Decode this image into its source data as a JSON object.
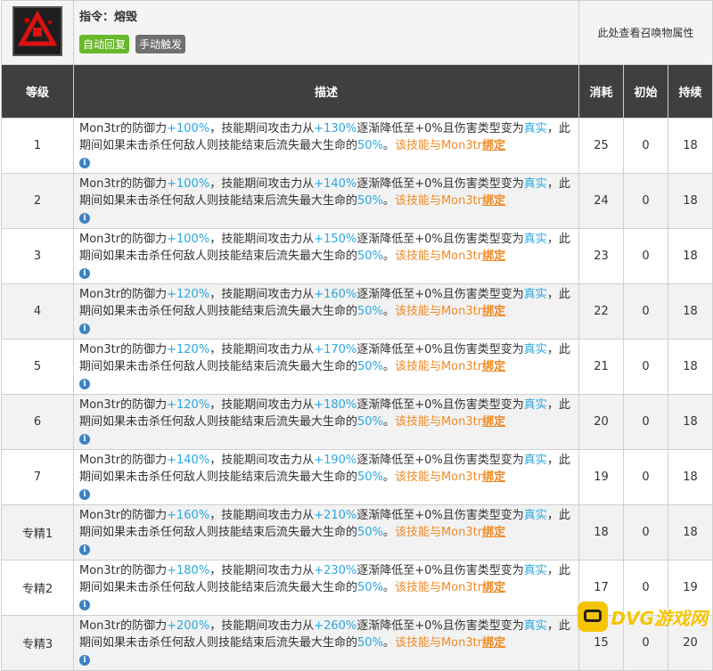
{
  "skill": {
    "title": "指令：熔毁",
    "tag_recovery": "自动回复",
    "tag_trigger": "手动触发",
    "summon_link": "此处查看召唤物属性"
  },
  "columns": {
    "level": "等级",
    "description": "描述",
    "cost": "消耗",
    "initial": "初始",
    "duration": "持续"
  },
  "desc_parts": {
    "p1": "Mon3tr的防御力",
    "p2": "，技能期间攻击力从",
    "p3": "逐渐降低至+0%且伤害类型变为",
    "true_dmg": "真实",
    "p4": "，此期间如果未击杀任何敌人则技能结束后流失最大生命的",
    "hp_loss": "50%",
    "p5": "。",
    "bind_text": "该技能与Mon3tr",
    "bind_link": "绑定"
  },
  "rows": [
    {
      "level": "1",
      "def": "+100%",
      "atk": "+130%",
      "cost": "25",
      "initial": "0",
      "duration": "18"
    },
    {
      "level": "2",
      "def": "+100%",
      "atk": "+140%",
      "cost": "24",
      "initial": "0",
      "duration": "18"
    },
    {
      "level": "3",
      "def": "+100%",
      "atk": "+150%",
      "cost": "23",
      "initial": "0",
      "duration": "18"
    },
    {
      "level": "4",
      "def": "+120%",
      "atk": "+160%",
      "cost": "22",
      "initial": "0",
      "duration": "18"
    },
    {
      "level": "5",
      "def": "+120%",
      "atk": "+170%",
      "cost": "21",
      "initial": "0",
      "duration": "18"
    },
    {
      "level": "6",
      "def": "+120%",
      "atk": "+180%",
      "cost": "20",
      "initial": "0",
      "duration": "18"
    },
    {
      "level": "7",
      "def": "+140%",
      "atk": "+190%",
      "cost": "19",
      "initial": "0",
      "duration": "18"
    },
    {
      "level": "专精1",
      "def": "+160%",
      "atk": "+210%",
      "cost": "18",
      "initial": "0",
      "duration": "18"
    },
    {
      "level": "专精2",
      "def": "+180%",
      "atk": "+230%",
      "cost": "17",
      "initial": "0",
      "duration": "19"
    },
    {
      "level": "专精3",
      "def": "+200%",
      "atk": "+260%",
      "cost": "15",
      "initial": "0",
      "duration": "20"
    }
  ],
  "watermark": {
    "text": "DVG游戏网"
  },
  "colors": {
    "accent_blue": "#2aa7e0",
    "accent_orange": "#f08a24",
    "tag_green": "#69b82b",
    "header_dark": "#3f3f3f"
  }
}
